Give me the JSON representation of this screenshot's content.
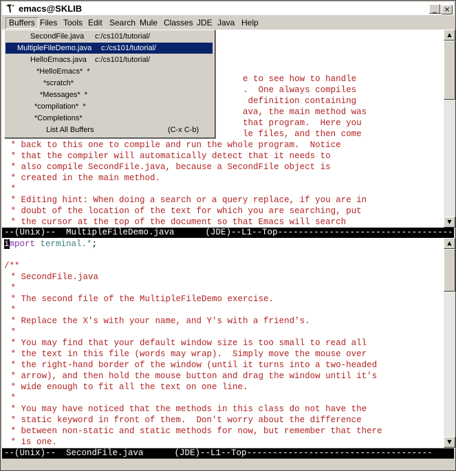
{
  "window": {
    "title": "emacs@SKLIB",
    "buttons": {
      "minimize": "_",
      "maximize": "□",
      "close": "×"
    }
  },
  "menubar": {
    "items": [
      "Buffers",
      "Files",
      "Tools",
      "Edit",
      "Search",
      "Mule",
      "Classes",
      "JDE",
      "Java",
      "Help"
    ],
    "active": "Buffers"
  },
  "buffers_menu": {
    "items": [
      {
        "name": "SecondFile.java",
        "path": "c:/cs101/tutorial/"
      },
      {
        "name": "MultipleFileDemo.java",
        "path": "c:/cs101/tutorial/",
        "selected": true
      },
      {
        "name": "HelloEmacs.java",
        "path": "c:/cs101/tutorial/"
      },
      {
        "name": "*HelloEmacs*  *",
        "path": ""
      },
      {
        "name": "*scratch*",
        "path": ""
      },
      {
        "name": "*Messages*  *",
        "path": ""
      },
      {
        "name": "*compilation*  *",
        "path": ""
      },
      {
        "name": "*Completions*",
        "path": ""
      },
      {
        "name": "List All Buffers",
        "path": "(C-x C-b)"
      }
    ]
  },
  "top_pane": {
    "lines": [
      "                                              e to see how to handle",
      "                                              .  One always compiles",
      "                                               definition containing",
      "                                              ava, the main method was",
      "                                              that program.  Here you",
      "                                              le files, and then come",
      " * back to this one to compile and run the whole program.  Notice",
      " * that the compiler will automatically detect that it needs to",
      " * also compile SecondFile.java, because a SecondFile object is",
      " * created in the main method.",
      " *",
      " * Editing hint: When doing a search or a query replace, if you are in",
      " * doubt of the location of the text for which you are searching, put",
      " * the cursor at the top of the document so that Emacs will search"
    ],
    "modeline": "--(Unix)--  MultipleFileDemo.java      (JDE)--L1--Top------------------------------------"
  },
  "bottom_pane": {
    "import_line": {
      "cursor": "i",
      "keyword": "mport",
      "package": "terminal.*",
      "end": ";"
    },
    "lines": [
      "",
      "/**",
      " * SecondFile.java",
      " *",
      " * The second file of the MultipleFileDemo exercise.",
      " *",
      " * Replace the X's with your name, and Y's with a friend's.",
      " *",
      " * You may find that your default window size is too small to read all",
      " * the text in this file (words may wrap).  Simply move the mouse over",
      " * the right-hand border of the window (until it turns into a two-headed",
      " * arrow), and then hold the mouse button and drag the window until it's",
      " * wide enough to fit all the text on one line.",
      " *",
      " * You may have noticed that the methods in this class do not have the",
      " * static keyword in front of them.  Don't worry about the difference",
      " * between non-static and static methods for now, but remember that there",
      " * is one."
    ],
    "modeline": "--(Unix)--  SecondFile.java      (JDE)--L1--Top------------------------------------"
  },
  "scroll_arrows": {
    "up": "▲",
    "down": "▼"
  }
}
